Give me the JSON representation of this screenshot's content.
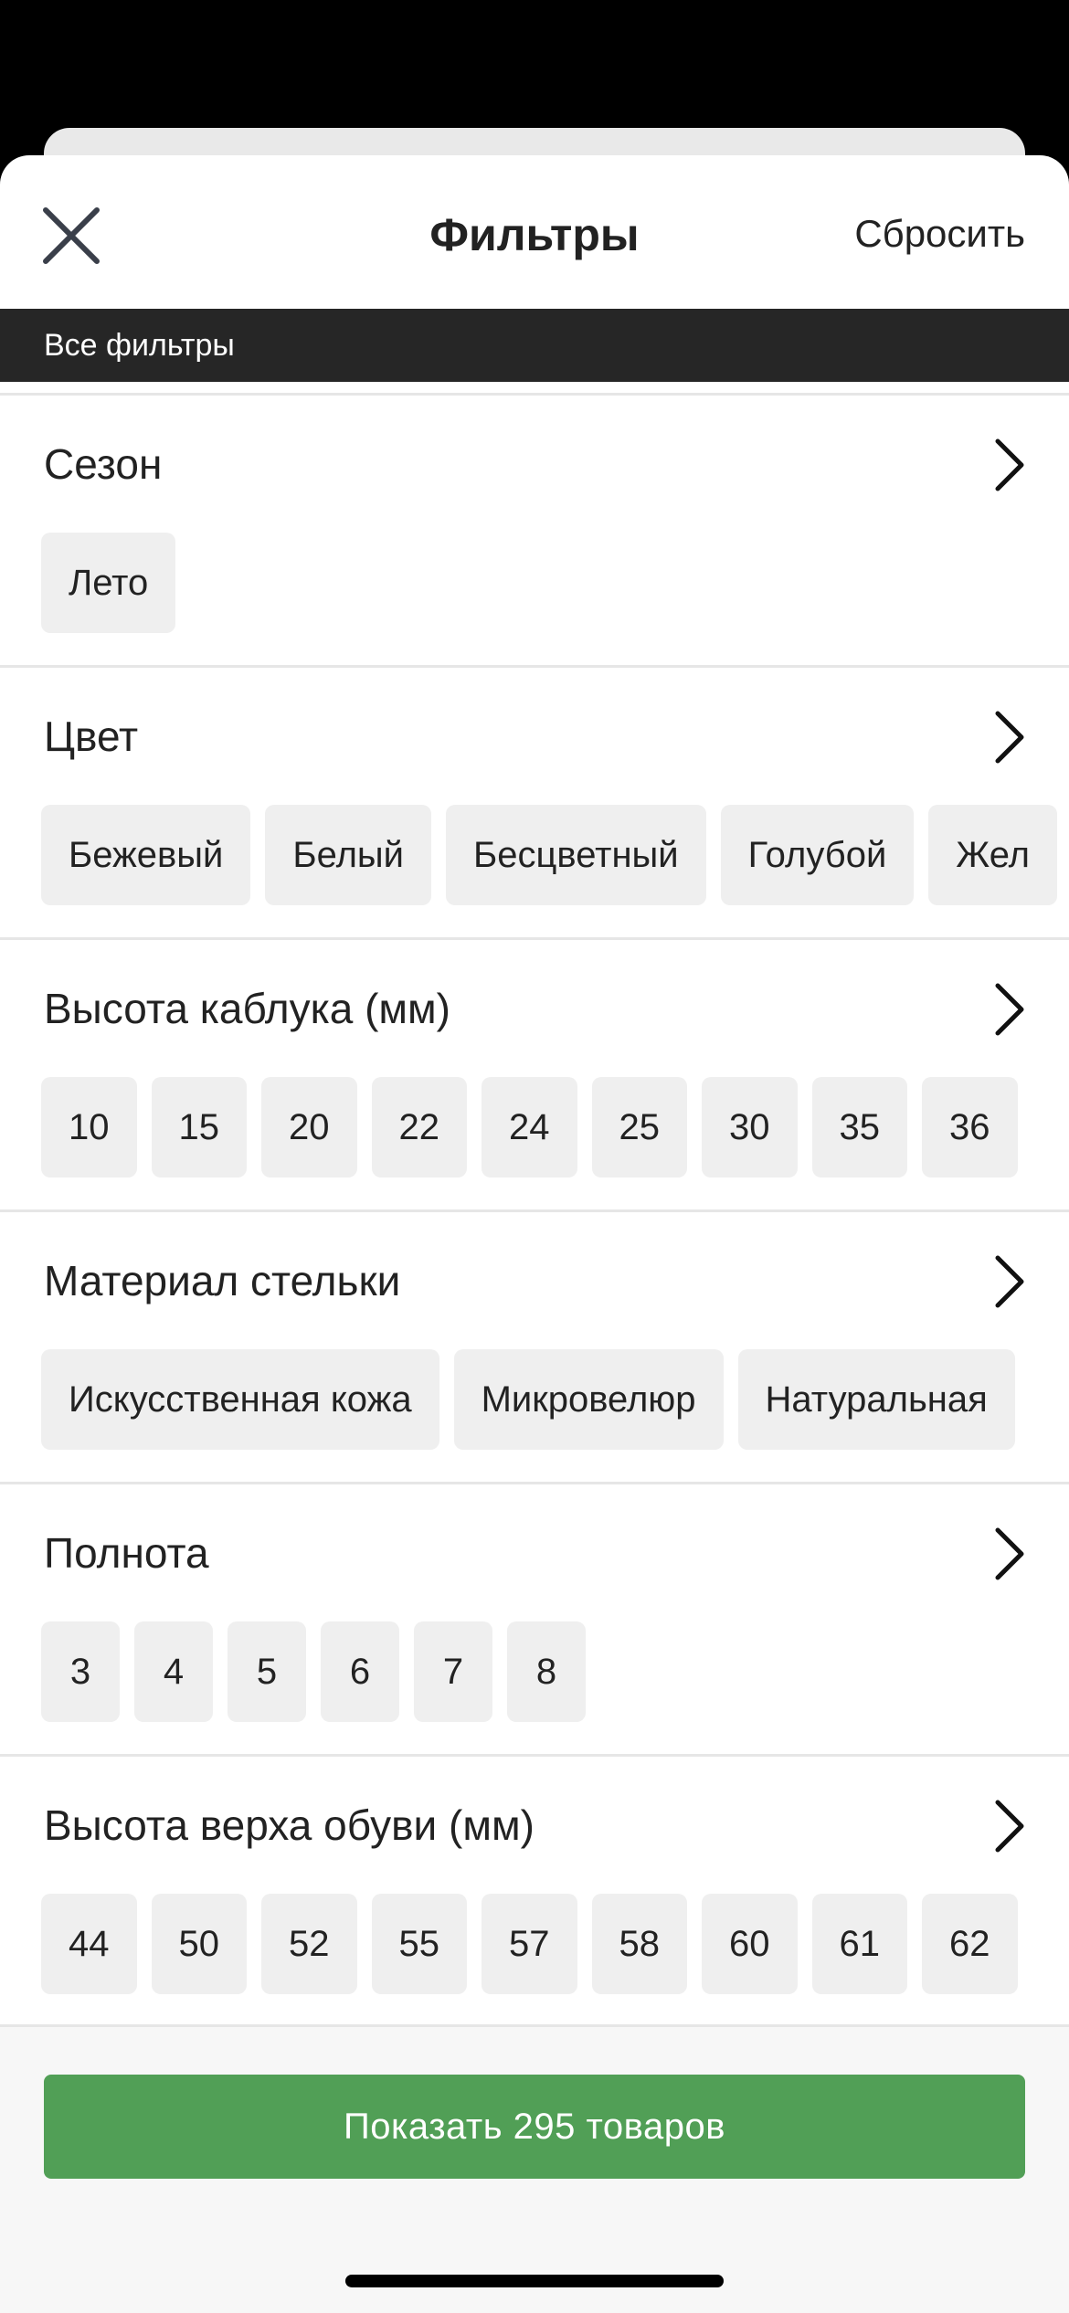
{
  "header": {
    "title": "Фильтры",
    "reset_label": "Сбросить"
  },
  "breadcrumb": "Все фильтры",
  "sections": [
    {
      "title": "Сезон",
      "chips": [
        "Лето"
      ]
    },
    {
      "title": "Цвет",
      "chips": [
        "Бежевый",
        "Белый",
        "Бесцветный",
        "Голубой",
        "Жел"
      ]
    },
    {
      "title": "Высота каблука (мм)",
      "chips": [
        "10",
        "15",
        "20",
        "22",
        "24",
        "25",
        "30",
        "35",
        "36"
      ]
    },
    {
      "title": "Материал стельки",
      "chips": [
        "Искусственная кожа",
        "Микровелюр",
        "Натуральная"
      ]
    },
    {
      "title": "Полнота",
      "chips": [
        "3",
        "4",
        "5",
        "6",
        "7",
        "8"
      ]
    },
    {
      "title": "Высота верха обуви (мм)",
      "chips": [
        "44",
        "50",
        "52",
        "55",
        "57",
        "58",
        "60",
        "61",
        "62"
      ]
    }
  ],
  "footer": {
    "show_button_label": "Показать 295 товаров"
  },
  "colors": {
    "accent_green": "#519f56",
    "breadcrumb_bg": "#262626",
    "chip_bg": "#efefef"
  },
  "icons": {
    "close": "close-icon",
    "chevron": "chevron-right-icon"
  }
}
